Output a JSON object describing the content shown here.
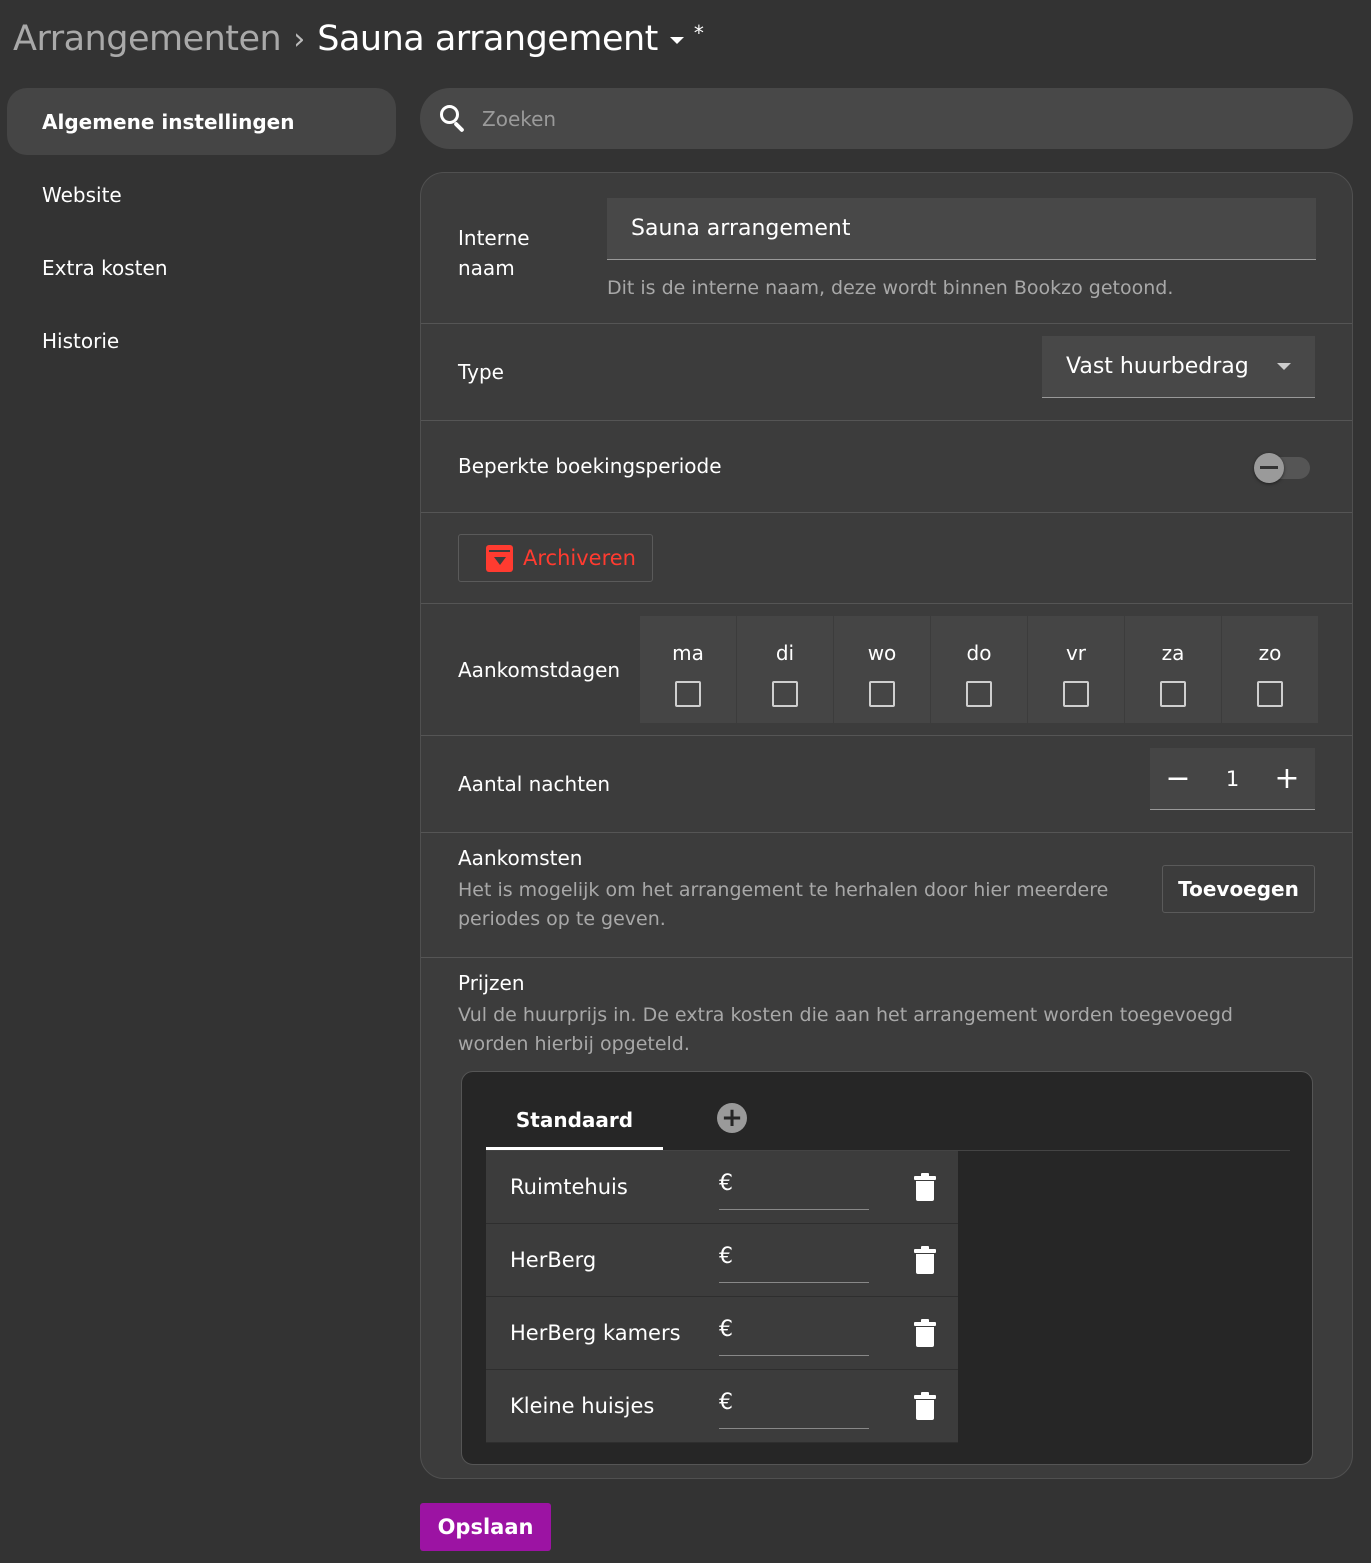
{
  "breadcrumb": {
    "parent": "Arrangementen",
    "separator": "›",
    "current": "Sauna arrangement",
    "modified": "*"
  },
  "sidebar": {
    "items": [
      {
        "label": "Algemene instellingen",
        "active": true
      },
      {
        "label": "Website"
      },
      {
        "label": "Extra kosten"
      },
      {
        "label": "Historie"
      }
    ]
  },
  "search": {
    "placeholder": "Zoeken",
    "value": ""
  },
  "form": {
    "internal_name": {
      "label_line1": "Interne",
      "label_line2": "naam",
      "value": "Sauna arrangement",
      "hint": "Dit is de interne naam, deze wordt binnen Bookzo getoond."
    },
    "type": {
      "label": "Type",
      "value": "Vast huurbedrag"
    },
    "restricted": {
      "label": "Beperkte boekingsperiode",
      "enabled": false
    },
    "archive": {
      "label": "Archiveren"
    },
    "arrival_days": {
      "label": "Aankomstdagen",
      "days": [
        "ma",
        "di",
        "wo",
        "do",
        "vr",
        "za",
        "zo"
      ],
      "checked": [
        false,
        false,
        false,
        false,
        false,
        false,
        false
      ]
    },
    "nights": {
      "label": "Aantal nachten",
      "value": "1",
      "minus": "−",
      "plus": "+"
    },
    "arrivals": {
      "title": "Aankomsten",
      "description_line1": "Het is mogelijk om het arrangement te herhalen door hier meerdere",
      "description_line2": "periodes op te geven.",
      "button": "Toevoegen"
    },
    "prices": {
      "title": "Prijzen",
      "description_line1": "Vul de huurprijs in. De extra kosten die aan het arrangement worden toegevoegd",
      "description_line2": "worden hierbij opgeteld.",
      "tab": "Standaard",
      "tab_add": "+",
      "currency": "€",
      "rows": [
        {
          "name": "Ruimtehuis",
          "value": ""
        },
        {
          "name": "HerBerg",
          "value": ""
        },
        {
          "name": "HerBerg kamers",
          "value": ""
        },
        {
          "name": "Kleine huisjes",
          "value": ""
        }
      ]
    }
  },
  "save_button": "Opslaan",
  "colors": {
    "background": "#333333",
    "card": "#3c3c3c",
    "accent": "#9c13a3",
    "danger": "#ff3b30"
  }
}
